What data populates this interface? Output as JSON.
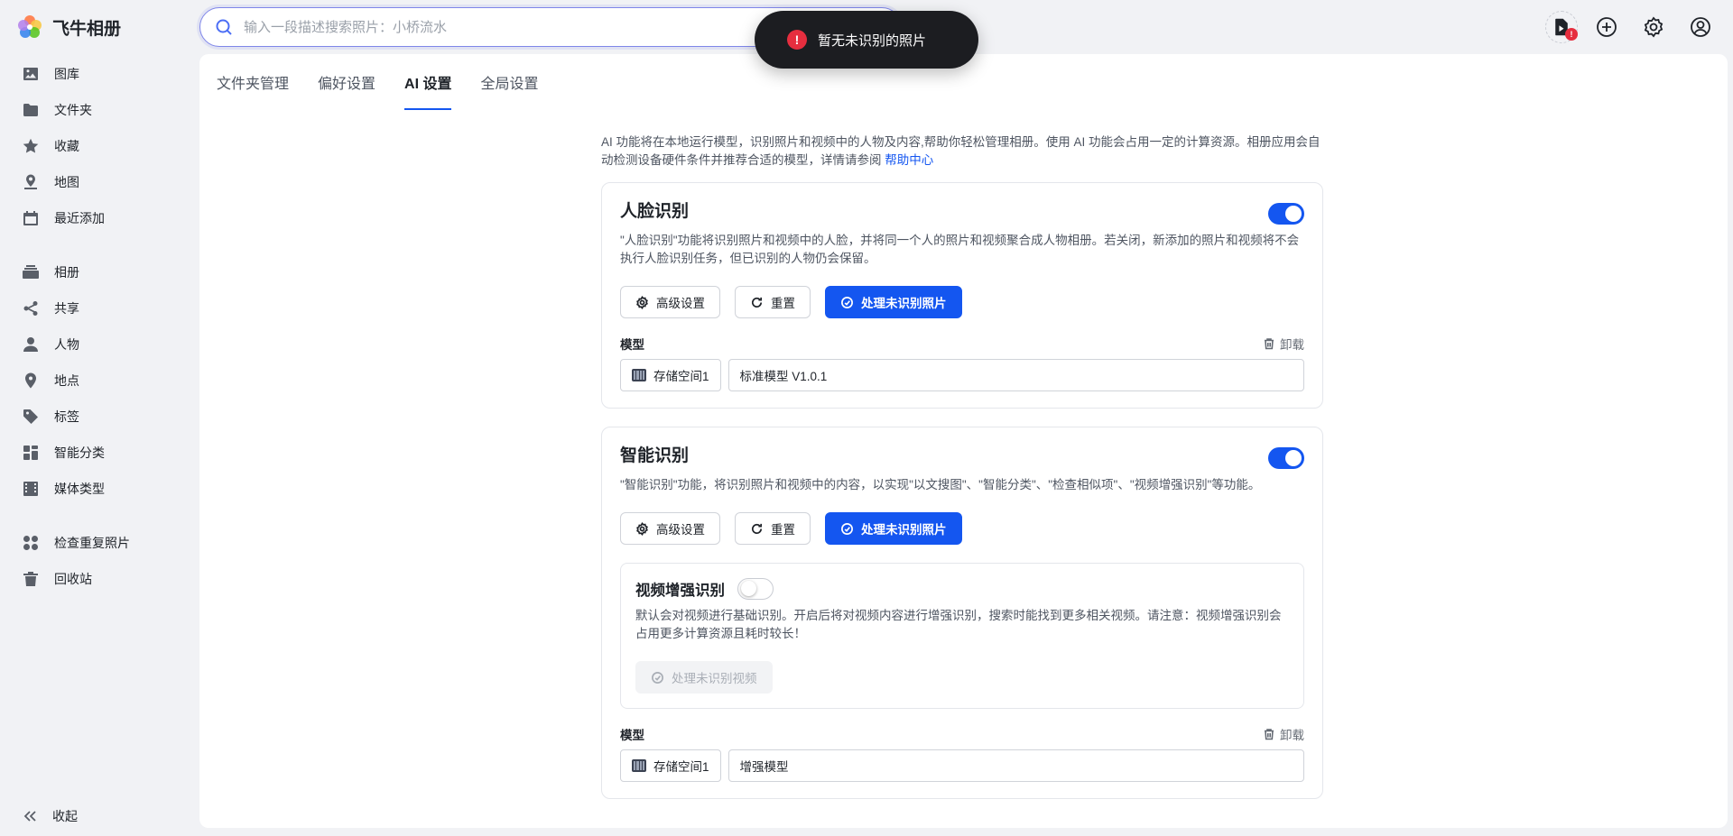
{
  "app": {
    "name": "飞牛相册"
  },
  "search": {
    "placeholder": "输入一段描述搜索照片：小桥流水"
  },
  "toast": {
    "message": "暂无未识别的照片"
  },
  "sidebar": {
    "items": [
      {
        "label": "图库",
        "icon": "gallery-icon"
      },
      {
        "label": "文件夹",
        "icon": "folder-icon"
      },
      {
        "label": "收藏",
        "icon": "star-icon"
      },
      {
        "label": "地图",
        "icon": "map-icon"
      },
      {
        "label": "最近添加",
        "icon": "calendar-icon"
      },
      {
        "label": "相册",
        "icon": "album-icon"
      },
      {
        "label": "共享",
        "icon": "share-icon"
      },
      {
        "label": "人物",
        "icon": "person-icon"
      },
      {
        "label": "地点",
        "icon": "location-icon"
      },
      {
        "label": "标签",
        "icon": "tag-icon"
      },
      {
        "label": "智能分类",
        "icon": "grid-icon"
      },
      {
        "label": "媒体类型",
        "icon": "film-icon"
      },
      {
        "label": "检查重复照片",
        "icon": "duplicate-icon"
      },
      {
        "label": "回收站",
        "icon": "trash-icon"
      }
    ],
    "collapse_label": "收起"
  },
  "tabs": [
    {
      "label": "文件夹管理"
    },
    {
      "label": "偏好设置"
    },
    {
      "label": "AI 设置"
    },
    {
      "label": "全局设置"
    }
  ],
  "intro": {
    "text": "AI 功能将在本地运行模型，识别照片和视频中的人物及内容,帮助你轻松管理相册。使用 AI 功能会占用一定的计算资源。相册应用会自动检测设备硬件条件并推荐合适的模型，详情请参阅 ",
    "link": "帮助中心"
  },
  "face": {
    "title": "人脸识别",
    "desc": "\"人脸识别\"功能将识别照片和视频中的人脸，并将同一个人的照片和视频聚合成人物相册。若关闭，新添加的照片和视频将不会执行人脸识别任务，但已识别的人物仍会保留。",
    "btn_advanced": "高级设置",
    "btn_reset": "重置",
    "btn_process": "处理未识别照片",
    "model_label": "模型",
    "uninstall": "卸载",
    "storage": "存储空间1",
    "model": "标准模型 V1.0.1"
  },
  "smart": {
    "title": "智能识别",
    "desc": "\"智能识别\"功能，将识别照片和视频中的内容，以实现\"以文搜图\"、\"智能分类\"、\"检查相似项\"、\"视频增强识别\"等功能。",
    "btn_advanced": "高级设置",
    "btn_reset": "重置",
    "btn_process": "处理未识别照片",
    "video": {
      "title": "视频增强识别",
      "desc": "默认会对视频进行基础识别。开启后将对视频内容进行增强识别，搜索时能找到更多相关视频。请注意：视频增强识别会占用更多计算资源且耗时较长！",
      "btn_process": "处理未识别视频"
    },
    "model_label": "模型",
    "uninstall": "卸载",
    "storage": "存储空间1",
    "model": "增强模型"
  },
  "colors": {
    "primary": "#1456f0",
    "toast_bg": "#1c1d21",
    "error": "#e62e3f"
  }
}
